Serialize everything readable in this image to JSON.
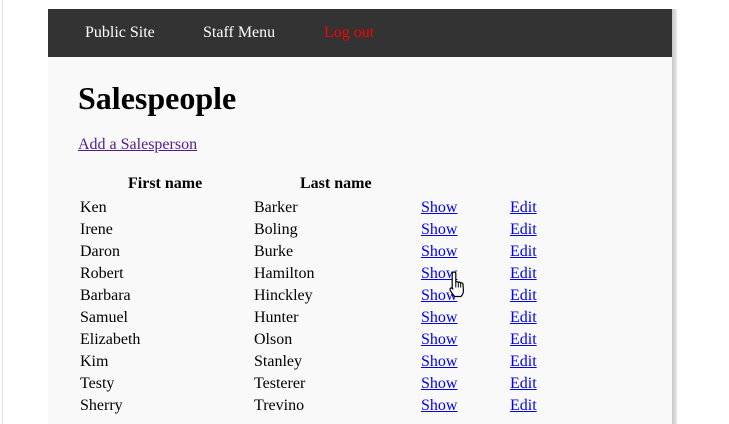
{
  "nav": {
    "public_site": "Public Site",
    "staff_menu": "Staff Menu",
    "log_out": "Log out"
  },
  "page": {
    "title": "Salespeople",
    "add_link": "Add a Salesperson"
  },
  "table": {
    "headers": [
      "First name",
      "Last name"
    ],
    "rows": [
      {
        "first": "Ken",
        "last": "Barker",
        "show": "Show",
        "edit": "Edit"
      },
      {
        "first": "Irene",
        "last": "Boling",
        "show": "Show",
        "edit": "Edit"
      },
      {
        "first": "Daron",
        "last": "Burke",
        "show": "Show",
        "edit": "Edit"
      },
      {
        "first": "Robert",
        "last": "Hamilton",
        "show": "Show",
        "edit": "Edit"
      },
      {
        "first": "Barbara",
        "last": "Hinckley",
        "show": "Show",
        "edit": "Edit"
      },
      {
        "first": "Samuel",
        "last": "Hunter",
        "show": "Show",
        "edit": "Edit"
      },
      {
        "first": "Elizabeth",
        "last": "Olson",
        "show": "Show",
        "edit": "Edit"
      },
      {
        "first": "Kim",
        "last": "Stanley",
        "show": "Show",
        "edit": "Edit"
      },
      {
        "first": "Testy",
        "last": "Testerer",
        "show": "Show",
        "edit": "Edit"
      },
      {
        "first": "Sherry",
        "last": "Trevino",
        "show": "Show",
        "edit": "Edit"
      }
    ]
  },
  "colors": {
    "navbar_bg": "#333333",
    "nav_link": "#ffffff",
    "logout_link": "#ff0000",
    "link": "#0000ee",
    "visited_link": "#551a8b",
    "page_bg": "#f9f9f9"
  },
  "icons": {
    "cursor": "hand-pointer-icon"
  }
}
